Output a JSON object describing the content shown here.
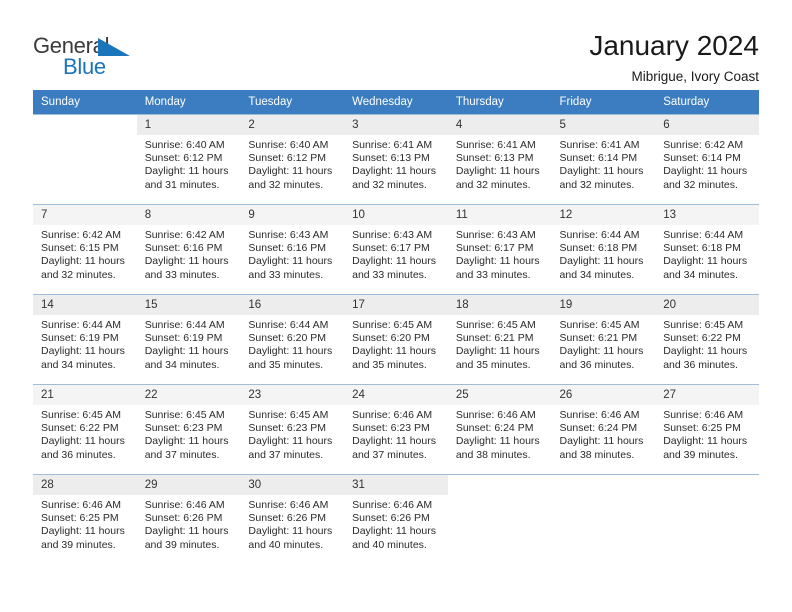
{
  "brand": {
    "name_top": "General",
    "name_bottom": "Blue",
    "triangle_color": "#1b75bb",
    "text_color": "#3b3b3b"
  },
  "header": {
    "title": "January 2024",
    "subtitle": "Mibrigue, Ivory Coast"
  },
  "theme": {
    "header_bg": "#3b7dc0",
    "header_text": "#ffffff",
    "daynum_bg": "#f2f2f2",
    "row_border": "#9fbcd8"
  },
  "weekday_headers": [
    "Sunday",
    "Monday",
    "Tuesday",
    "Wednesday",
    "Thursday",
    "Friday",
    "Saturday"
  ],
  "weeks": [
    [
      {
        "day": "",
        "sunrise": "",
        "sunset": "",
        "daylight1": "",
        "daylight2": ""
      },
      {
        "day": "1",
        "sunrise": "Sunrise: 6:40 AM",
        "sunset": "Sunset: 6:12 PM",
        "daylight1": "Daylight: 11 hours",
        "daylight2": "and 31 minutes."
      },
      {
        "day": "2",
        "sunrise": "Sunrise: 6:40 AM",
        "sunset": "Sunset: 6:12 PM",
        "daylight1": "Daylight: 11 hours",
        "daylight2": "and 32 minutes."
      },
      {
        "day": "3",
        "sunrise": "Sunrise: 6:41 AM",
        "sunset": "Sunset: 6:13 PM",
        "daylight1": "Daylight: 11 hours",
        "daylight2": "and 32 minutes."
      },
      {
        "day": "4",
        "sunrise": "Sunrise: 6:41 AM",
        "sunset": "Sunset: 6:13 PM",
        "daylight1": "Daylight: 11 hours",
        "daylight2": "and 32 minutes."
      },
      {
        "day": "5",
        "sunrise": "Sunrise: 6:41 AM",
        "sunset": "Sunset: 6:14 PM",
        "daylight1": "Daylight: 11 hours",
        "daylight2": "and 32 minutes."
      },
      {
        "day": "6",
        "sunrise": "Sunrise: 6:42 AM",
        "sunset": "Sunset: 6:14 PM",
        "daylight1": "Daylight: 11 hours",
        "daylight2": "and 32 minutes."
      }
    ],
    [
      {
        "day": "7",
        "sunrise": "Sunrise: 6:42 AM",
        "sunset": "Sunset: 6:15 PM",
        "daylight1": "Daylight: 11 hours",
        "daylight2": "and 32 minutes."
      },
      {
        "day": "8",
        "sunrise": "Sunrise: 6:42 AM",
        "sunset": "Sunset: 6:16 PM",
        "daylight1": "Daylight: 11 hours",
        "daylight2": "and 33 minutes."
      },
      {
        "day": "9",
        "sunrise": "Sunrise: 6:43 AM",
        "sunset": "Sunset: 6:16 PM",
        "daylight1": "Daylight: 11 hours",
        "daylight2": "and 33 minutes."
      },
      {
        "day": "10",
        "sunrise": "Sunrise: 6:43 AM",
        "sunset": "Sunset: 6:17 PM",
        "daylight1": "Daylight: 11 hours",
        "daylight2": "and 33 minutes."
      },
      {
        "day": "11",
        "sunrise": "Sunrise: 6:43 AM",
        "sunset": "Sunset: 6:17 PM",
        "daylight1": "Daylight: 11 hours",
        "daylight2": "and 33 minutes."
      },
      {
        "day": "12",
        "sunrise": "Sunrise: 6:44 AM",
        "sunset": "Sunset: 6:18 PM",
        "daylight1": "Daylight: 11 hours",
        "daylight2": "and 34 minutes."
      },
      {
        "day": "13",
        "sunrise": "Sunrise: 6:44 AM",
        "sunset": "Sunset: 6:18 PM",
        "daylight1": "Daylight: 11 hours",
        "daylight2": "and 34 minutes."
      }
    ],
    [
      {
        "day": "14",
        "sunrise": "Sunrise: 6:44 AM",
        "sunset": "Sunset: 6:19 PM",
        "daylight1": "Daylight: 11 hours",
        "daylight2": "and 34 minutes."
      },
      {
        "day": "15",
        "sunrise": "Sunrise: 6:44 AM",
        "sunset": "Sunset: 6:19 PM",
        "daylight1": "Daylight: 11 hours",
        "daylight2": "and 34 minutes."
      },
      {
        "day": "16",
        "sunrise": "Sunrise: 6:44 AM",
        "sunset": "Sunset: 6:20 PM",
        "daylight1": "Daylight: 11 hours",
        "daylight2": "and 35 minutes."
      },
      {
        "day": "17",
        "sunrise": "Sunrise: 6:45 AM",
        "sunset": "Sunset: 6:20 PM",
        "daylight1": "Daylight: 11 hours",
        "daylight2": "and 35 minutes."
      },
      {
        "day": "18",
        "sunrise": "Sunrise: 6:45 AM",
        "sunset": "Sunset: 6:21 PM",
        "daylight1": "Daylight: 11 hours",
        "daylight2": "and 35 minutes."
      },
      {
        "day": "19",
        "sunrise": "Sunrise: 6:45 AM",
        "sunset": "Sunset: 6:21 PM",
        "daylight1": "Daylight: 11 hours",
        "daylight2": "and 36 minutes."
      },
      {
        "day": "20",
        "sunrise": "Sunrise: 6:45 AM",
        "sunset": "Sunset: 6:22 PM",
        "daylight1": "Daylight: 11 hours",
        "daylight2": "and 36 minutes."
      }
    ],
    [
      {
        "day": "21",
        "sunrise": "Sunrise: 6:45 AM",
        "sunset": "Sunset: 6:22 PM",
        "daylight1": "Daylight: 11 hours",
        "daylight2": "and 36 minutes."
      },
      {
        "day": "22",
        "sunrise": "Sunrise: 6:45 AM",
        "sunset": "Sunset: 6:23 PM",
        "daylight1": "Daylight: 11 hours",
        "daylight2": "and 37 minutes."
      },
      {
        "day": "23",
        "sunrise": "Sunrise: 6:45 AM",
        "sunset": "Sunset: 6:23 PM",
        "daylight1": "Daylight: 11 hours",
        "daylight2": "and 37 minutes."
      },
      {
        "day": "24",
        "sunrise": "Sunrise: 6:46 AM",
        "sunset": "Sunset: 6:23 PM",
        "daylight1": "Daylight: 11 hours",
        "daylight2": "and 37 minutes."
      },
      {
        "day": "25",
        "sunrise": "Sunrise: 6:46 AM",
        "sunset": "Sunset: 6:24 PM",
        "daylight1": "Daylight: 11 hours",
        "daylight2": "and 38 minutes."
      },
      {
        "day": "26",
        "sunrise": "Sunrise: 6:46 AM",
        "sunset": "Sunset: 6:24 PM",
        "daylight1": "Daylight: 11 hours",
        "daylight2": "and 38 minutes."
      },
      {
        "day": "27",
        "sunrise": "Sunrise: 6:46 AM",
        "sunset": "Sunset: 6:25 PM",
        "daylight1": "Daylight: 11 hours",
        "daylight2": "and 39 minutes."
      }
    ],
    [
      {
        "day": "28",
        "sunrise": "Sunrise: 6:46 AM",
        "sunset": "Sunset: 6:25 PM",
        "daylight1": "Daylight: 11 hours",
        "daylight2": "and 39 minutes."
      },
      {
        "day": "29",
        "sunrise": "Sunrise: 6:46 AM",
        "sunset": "Sunset: 6:26 PM",
        "daylight1": "Daylight: 11 hours",
        "daylight2": "and 39 minutes."
      },
      {
        "day": "30",
        "sunrise": "Sunrise: 6:46 AM",
        "sunset": "Sunset: 6:26 PM",
        "daylight1": "Daylight: 11 hours",
        "daylight2": "and 40 minutes."
      },
      {
        "day": "31",
        "sunrise": "Sunrise: 6:46 AM",
        "sunset": "Sunset: 6:26 PM",
        "daylight1": "Daylight: 11 hours",
        "daylight2": "and 40 minutes."
      },
      {
        "day": "",
        "sunrise": "",
        "sunset": "",
        "daylight1": "",
        "daylight2": ""
      },
      {
        "day": "",
        "sunrise": "",
        "sunset": "",
        "daylight1": "",
        "daylight2": ""
      },
      {
        "day": "",
        "sunrise": "",
        "sunset": "",
        "daylight1": "",
        "daylight2": ""
      }
    ]
  ]
}
